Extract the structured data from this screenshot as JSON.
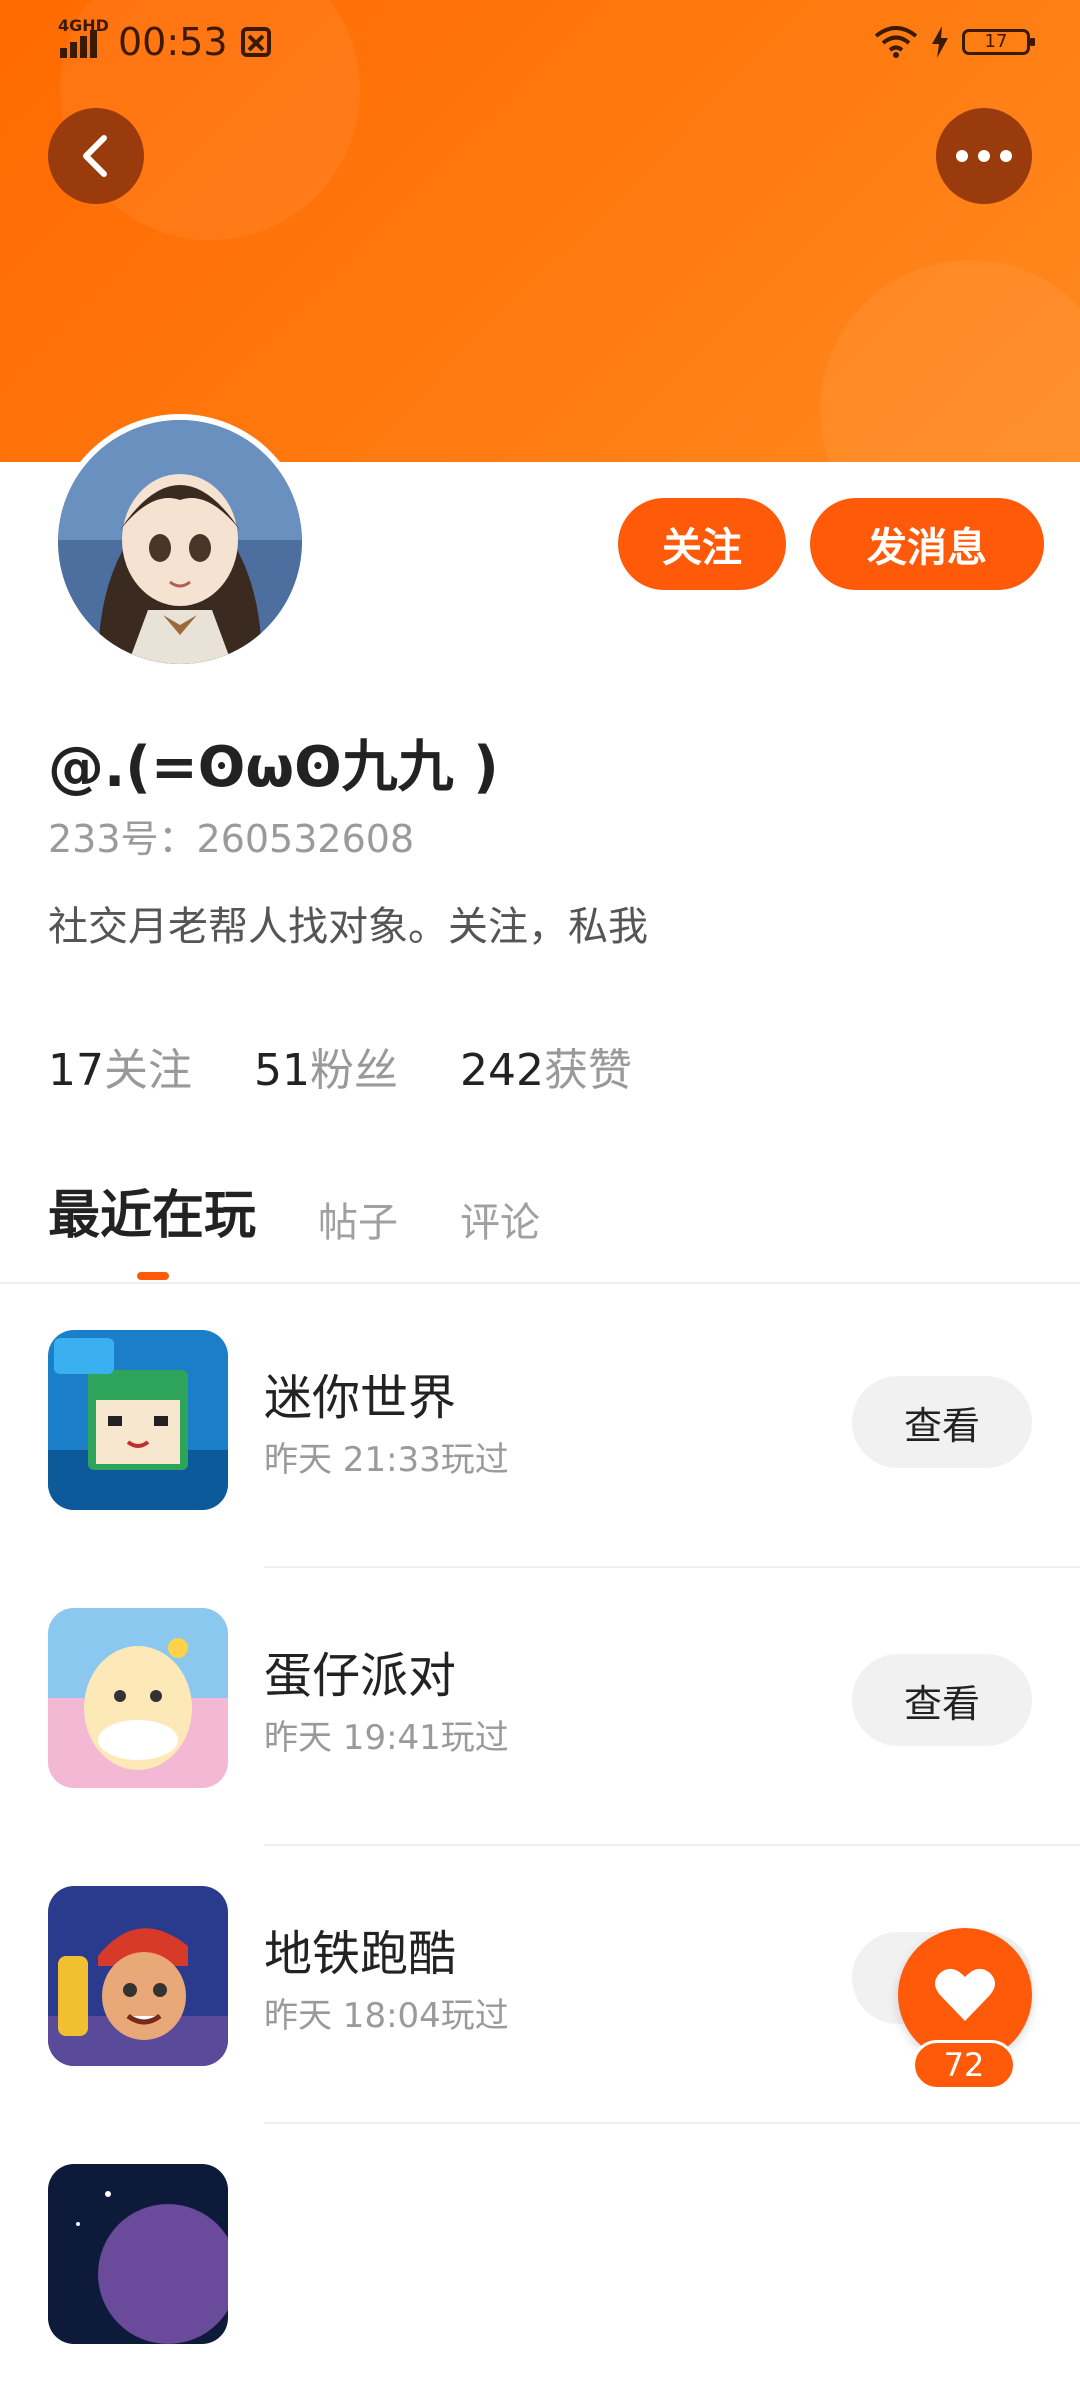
{
  "status_bar": {
    "network": "4GHD",
    "time": "00:53",
    "battery": "17"
  },
  "colors": {
    "accent": "#ff5a0a",
    "banner": "#ff7a10"
  },
  "profile": {
    "follow_label": "关注",
    "message_label": "发消息",
    "username": "@.(=ʘωʘ九九 )",
    "id_text": "233号：260532608",
    "bio": "社交月老帮人找对象。关注，私我",
    "stats": [
      {
        "num": "17",
        "label": "关注"
      },
      {
        "num": "51",
        "label": "粉丝"
      },
      {
        "num": "242",
        "label": "获赞"
      }
    ]
  },
  "tabs": [
    {
      "label": "最近在玩",
      "active": true
    },
    {
      "label": "帖子",
      "active": false
    },
    {
      "label": "评论",
      "active": false
    }
  ],
  "games": [
    {
      "name": "迷你世界",
      "time": "昨天 21:33玩过",
      "button": "查看",
      "icon": "mini-world-icon"
    },
    {
      "name": "蛋仔派对",
      "time": "昨天 19:41玩过",
      "button": "查看",
      "icon": "eggy-party-icon"
    },
    {
      "name": "地铁跑酷",
      "time": "昨天 18:04玩过",
      "button": "查看",
      "icon": "subway-surfers-icon"
    },
    {
      "name": "",
      "time": "",
      "button": "",
      "icon": "space-game-icon"
    }
  ],
  "like": {
    "count": "72"
  }
}
